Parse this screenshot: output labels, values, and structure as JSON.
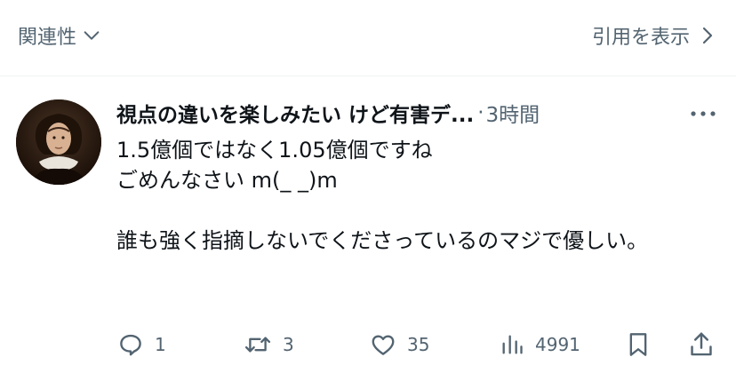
{
  "topbar": {
    "related_label": "関連性",
    "related_icon": "chevron-down-icon",
    "quote_label": "引用を表示",
    "quote_icon": "chevron-right-icon"
  },
  "tweet": {
    "display_name": "視点の違いを楽しみたい けど有害デ...",
    "separator": "·",
    "time": "3時間",
    "more_icon": "more-dots-icon",
    "text": "1.5億個ではなく1.05億個ですね\nごめんなさい m(_ _)m\n\n誰も強く指摘しないでくださっているのマジで優しい。",
    "actions": {
      "reply": {
        "icon": "reply-icon",
        "count": "1"
      },
      "retweet": {
        "icon": "retweet-icon",
        "count": "3"
      },
      "like": {
        "icon": "heart-icon",
        "count": "35"
      },
      "views": {
        "icon": "views-chart-icon",
        "count": "4991"
      },
      "bookmark": {
        "icon": "bookmark-icon"
      },
      "share": {
        "icon": "share-icon"
      }
    }
  },
  "colors": {
    "text_primary": "#0f1419",
    "text_secondary": "#536471",
    "divider": "#eff3f4"
  }
}
